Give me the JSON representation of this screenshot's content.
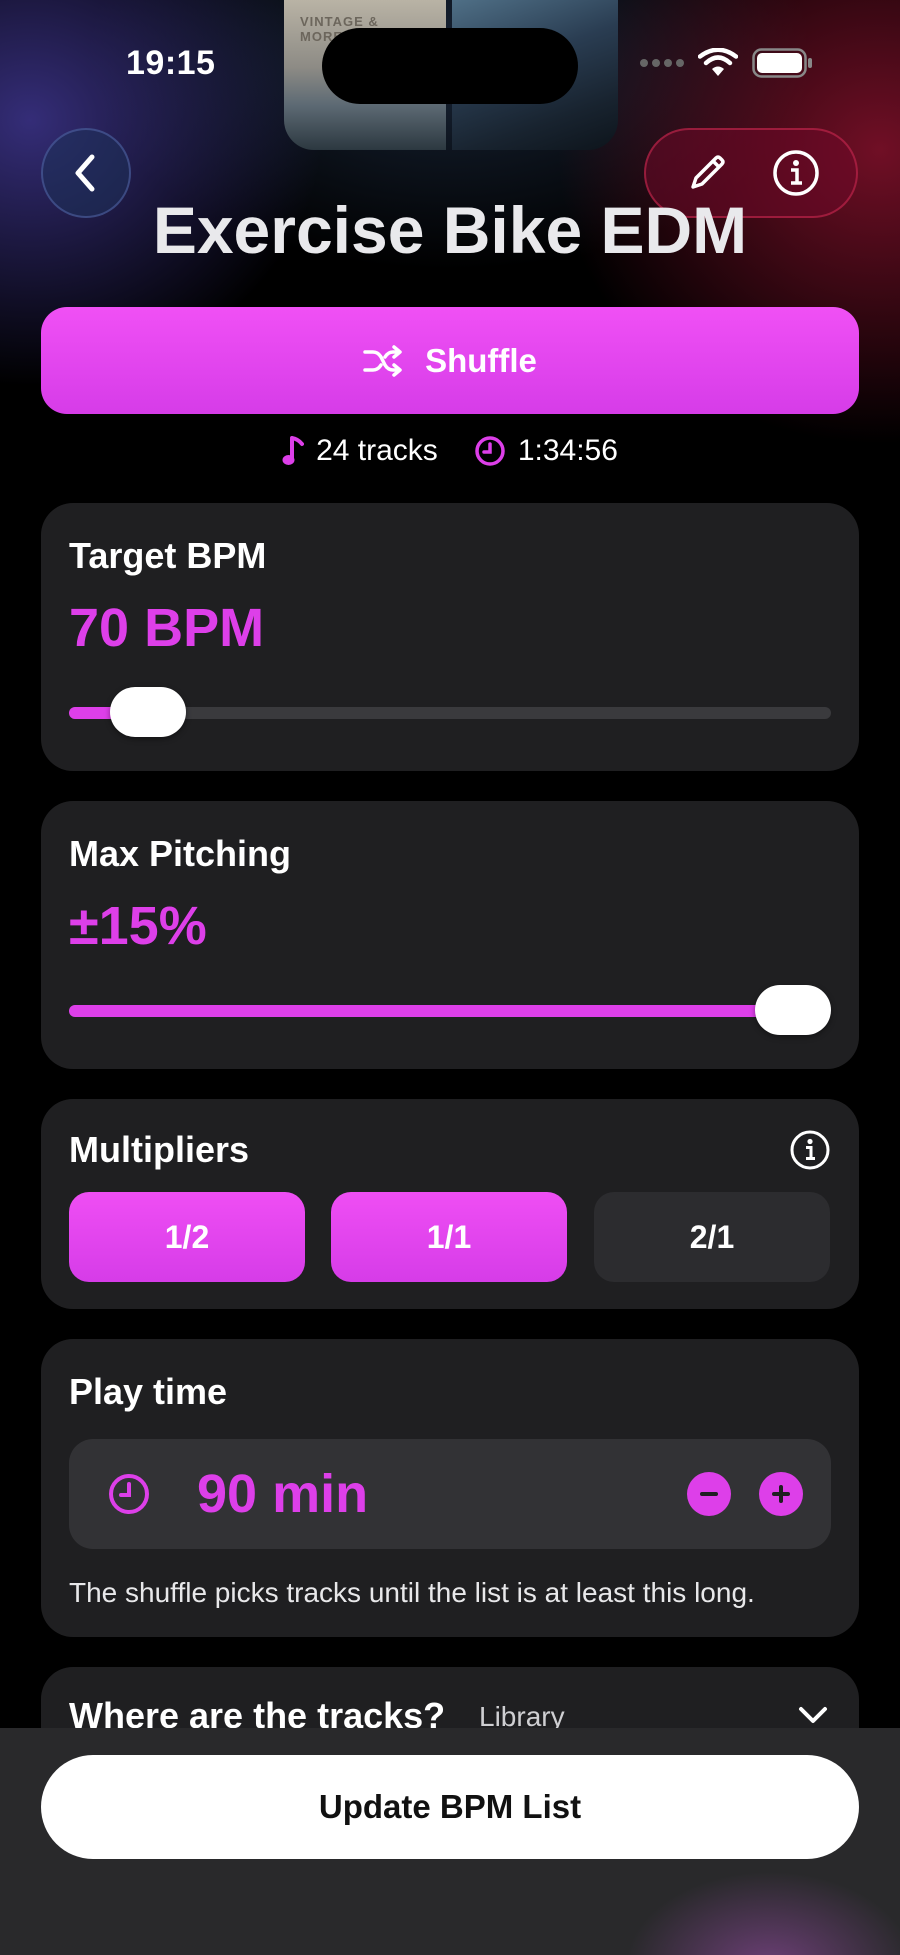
{
  "status_bar": {
    "time": "19:15"
  },
  "album_art": {
    "caption": "VINTAGE & MORELLI"
  },
  "header": {
    "title": "Exercise Bike EDM"
  },
  "shuffle": {
    "label": "Shuffle"
  },
  "meta": {
    "tracks": "24 tracks",
    "duration": "1:34:56"
  },
  "target_bpm": {
    "title": "Target BPM",
    "value": "70 BPM",
    "slider_fraction": 0.06
  },
  "max_pitching": {
    "title": "Max Pitching",
    "value": "±15%",
    "slider_fraction": 1.0
  },
  "multipliers": {
    "title": "Multipliers",
    "options": [
      {
        "label": "1/2",
        "selected": true
      },
      {
        "label": "1/1",
        "selected": true
      },
      {
        "label": "2/1",
        "selected": false
      }
    ]
  },
  "play_time": {
    "title": "Play time",
    "value": "90 min",
    "hint": "The shuffle picks tracks until the list is at least this long."
  },
  "tracks_location": {
    "title": "Where are the tracks?",
    "value": "Library"
  },
  "update_button": {
    "label": "Update BPM List"
  },
  "colors": {
    "accent": "#dd3fe9",
    "card": "#1f1f21",
    "background": "#000000"
  },
  "icons": [
    "chevron-left-icon",
    "pencil-icon",
    "info-icon",
    "shuffle-icon",
    "music-note-icon",
    "clock-icon",
    "minus-icon",
    "plus-icon",
    "chevron-down-icon",
    "wifi-icon",
    "battery-icon"
  ]
}
